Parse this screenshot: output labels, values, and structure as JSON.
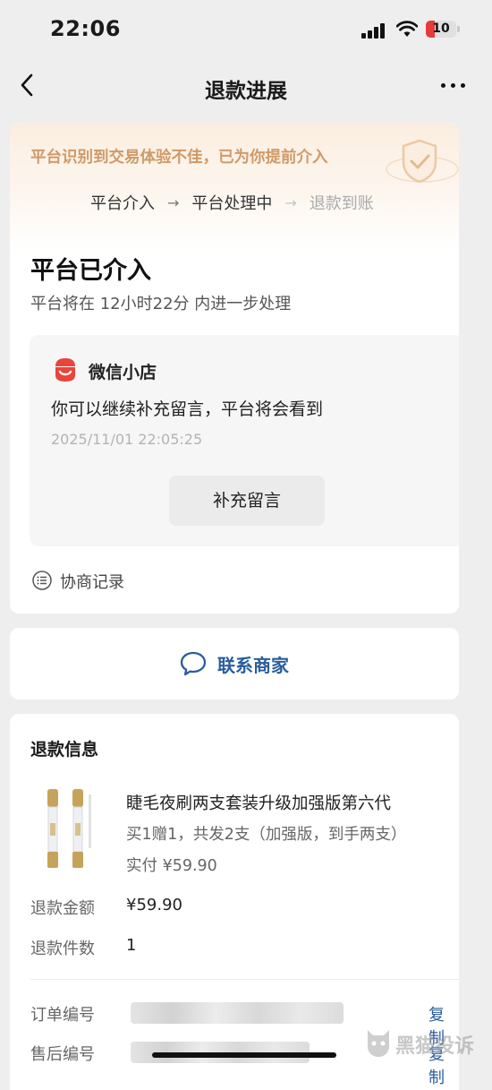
{
  "status_bar": {
    "time": "22:06",
    "battery": "10"
  },
  "nav": {
    "title": "退款进展"
  },
  "progress": {
    "banner": "平台识别到交易体验不佳，已为你提前介入",
    "steps": [
      "平台介入",
      "平台处理中",
      "退款到账"
    ],
    "title": "平台已介入",
    "subtitle": "平台将在 12小时22分 内进一步处理"
  },
  "message_box": {
    "shop_name": "微信小店",
    "text": "你可以继续补充留言，平台将会看到",
    "time": "2025/11/01 22:05:25",
    "button": "补充留言"
  },
  "history": {
    "label": "协商记录"
  },
  "contact": {
    "label": "联系商家"
  },
  "refund_info": {
    "title": "退款信息",
    "product_name": "睫毛夜刷两支套装升级加强版第六代",
    "product_spec": "买1赠1，共发2支（加强版，到手两支）",
    "product_paid": "实付 ¥59.90",
    "amount_label": "退款金额",
    "amount_value": "¥59.90",
    "qty_label": "退款件数",
    "qty_value": "1",
    "order_label": "订单编号",
    "aftersale_label": "售后编号",
    "copy_label": "复制"
  },
  "colors": {
    "accent_blue": "#2a5d9c",
    "banner_orange": "#cf9a68",
    "shop_red": "#e8453c"
  },
  "icons": [
    "back-icon",
    "more-icon",
    "shield-check-icon",
    "shop-icon",
    "list-icon",
    "chat-bubble-icon"
  ]
}
